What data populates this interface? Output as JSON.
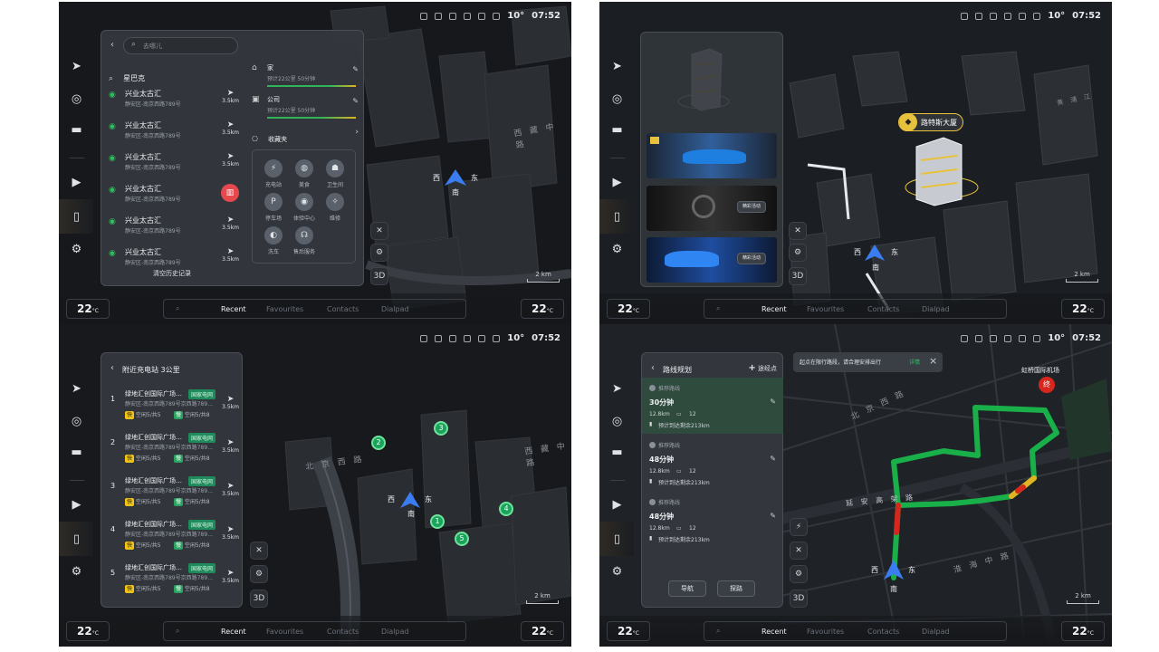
{
  "status": {
    "temp": "10°",
    "time": "07:52"
  },
  "bottom": {
    "temp_left": "22",
    "temp_right": "22",
    "unit": "°C",
    "tabs": [
      "Recent",
      "Favourites",
      "Contacts",
      "Dialpad"
    ],
    "active_tab": "Recent"
  },
  "map_common": {
    "west": "西",
    "east": "东",
    "south": "南",
    "scale": "2 km",
    "btn_3d": "3D"
  },
  "screen1": {
    "search_placeholder": "去哪儿",
    "first_result": "星巴克",
    "results": [
      {
        "name": "兴业太古汇",
        "addr": "静安区-南京西路789号",
        "dist": "3.5km"
      },
      {
        "name": "兴业太古汇",
        "addr": "静安区-南京西路789号",
        "dist": "3.5km"
      },
      {
        "name": "兴业太古汇",
        "addr": "静安区-南京西路789号",
        "dist": "3.5km"
      },
      {
        "name": "兴业太古汇",
        "addr": "静安区-南京西路789号",
        "dist": ""
      },
      {
        "name": "兴业太古汇",
        "addr": "静安区-南京西路789号",
        "dist": "3.5km"
      },
      {
        "name": "兴业太古汇",
        "addr": "静安区-南京西路789号",
        "dist": "3.5km"
      }
    ],
    "clear_history": "清空历史记录",
    "home": {
      "label": "家",
      "sub": "预计22公里 50分钟"
    },
    "work": {
      "label": "公司",
      "sub": "预计22公里 50分钟"
    },
    "favorites": "收藏夹",
    "categories": [
      "充电站",
      "美食",
      "卫生间",
      "停车场",
      "体验中心",
      "维修",
      "洗车",
      "售后服务"
    ],
    "road": "西 藏 中 路"
  },
  "screen2": {
    "landmark": "路特斯大厦",
    "cards": [
      "",
      "精彩活动",
      "精彩活动"
    ],
    "roads": [
      "黄 浦 江"
    ]
  },
  "screen3": {
    "title": "附近充电站 3公里",
    "stations": [
      {
        "num": "1",
        "name": "绿地汇创国际广场…",
        "addr": "静安区-南京西路789号京西路789…",
        "badge": "国家电网",
        "dist": "3.5km",
        "fast": "空闲5",
        "fast_total": "/共5",
        "slow": "空闲5",
        "slow_total": "/共8"
      },
      {
        "num": "2",
        "name": "绿地汇创国际广场…",
        "addr": "静安区-南京西路789号京西路789…",
        "badge": "国家电网",
        "dist": "3.5km",
        "fast": "空闲5",
        "fast_total": "/共5",
        "slow": "空闲5",
        "slow_total": "/共8"
      },
      {
        "num": "3",
        "name": "绿地汇创国际广场…",
        "addr": "静安区-南京西路789号京西路789…",
        "badge": "国家电网",
        "dist": "3.5km",
        "fast": "空闲5",
        "fast_total": "/共5",
        "slow": "空闲5",
        "slow_total": "/共8"
      },
      {
        "num": "4",
        "name": "绿地汇创国际广场…",
        "addr": "静安区-南京西路789号京西路789…",
        "badge": "国家电网",
        "dist": "3.5km",
        "fast": "空闲5",
        "fast_total": "/共5",
        "slow": "空闲5",
        "slow_total": "/共8"
      },
      {
        "num": "5",
        "name": "绿地汇创国际广场…",
        "addr": "静安区-南京西路789号京西路789…",
        "badge": "国家电网",
        "dist": "3.5km",
        "fast": "空闲5",
        "fast_total": "/共5",
        "slow": "空闲5",
        "slow_total": "/共8"
      }
    ],
    "fast_label": "快",
    "slow_label": "慢",
    "road_a": "北 京 西 路",
    "road_b": "西 藏 中 路",
    "pins": [
      "1",
      "2",
      "3",
      "4",
      "5"
    ]
  },
  "screen4": {
    "title": "路线规划",
    "add_waypoint": "途经点",
    "routes": [
      {
        "tag": "推荐路线",
        "time": "30分钟",
        "km": "12.8km",
        "lights": "12",
        "remain": "预计到达剩余213km"
      },
      {
        "tag": "推荐路线",
        "time": "48分钟",
        "km": "12.8km",
        "lights": "12",
        "remain": "预计到达剩余213km"
      },
      {
        "tag": "推荐路线",
        "time": "48分钟",
        "km": "12.8km",
        "lights": "12",
        "remain": "预计到达剩余213km"
      }
    ],
    "navigate": "导航",
    "explore": "探路",
    "alert": "起点在限行路段，请合理安排出行",
    "alert_detail": "详情",
    "destination": "虹桥国际机场",
    "end_marker": "终",
    "roads": [
      "北 京 西 路",
      "延 安 高 架 路",
      "淮 海 中 路"
    ]
  }
}
